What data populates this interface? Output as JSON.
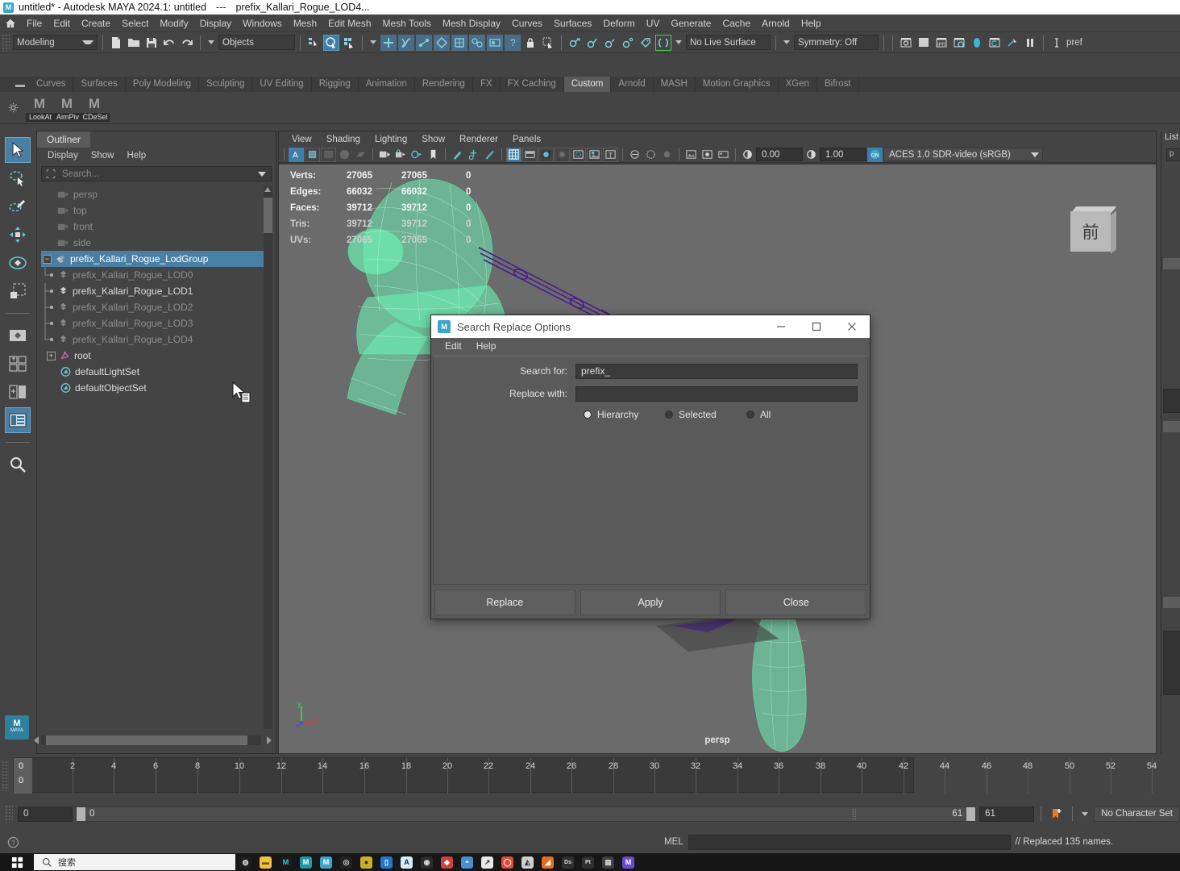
{
  "titlebar": {
    "app_icon": "maya-icon",
    "text": "untitled* - Autodesk MAYA 2024.1: untitled",
    "separator": "---",
    "object": "prefix_Kallari_Rogue_LOD4..."
  },
  "menubar": {
    "home_icon": "home-icon",
    "items": [
      "File",
      "Edit",
      "Create",
      "Select",
      "Modify",
      "Display",
      "Windows",
      "Mesh",
      "Edit Mesh",
      "Mesh Tools",
      "Mesh Display",
      "Curves",
      "Surfaces",
      "Deform",
      "UV",
      "Generate",
      "Cache",
      "Arnold",
      "Help"
    ]
  },
  "toolbar": {
    "mode": "Modeling",
    "objects": "Objects",
    "live_surface": "No Live Surface",
    "symmetry": "Symmetry: Off",
    "icons": [
      "new-scene-icon",
      "open-scene-icon",
      "save-scene-icon",
      "undo-icon",
      "redo-icon",
      "select-hierarchy-icon",
      "select-object-icon",
      "select-component-icon",
      "snap-grid-icon",
      "snap-curve-icon",
      "snap-point-icon",
      "snap-projected-icon",
      "snap-view-plane-icon",
      "make-live-icon",
      "render-icon",
      "render-sequence-icon",
      "ipr-render-icon",
      "render-settings-icon",
      "hypershade-icon",
      "render-view-icon",
      "light-editor-icon",
      "pause-icon",
      "text-cursor-icon"
    ]
  },
  "shelf": {
    "tabs": [
      "Curves",
      "Surfaces",
      "Poly Modeling",
      "Sculpting",
      "UV Editing",
      "Rigging",
      "Animation",
      "Rendering",
      "FX",
      "FX Caching",
      "Custom",
      "Arnold",
      "MASH",
      "Motion Graphics",
      "XGen",
      "Bifrost"
    ],
    "active_tab": "Custom",
    "buttons": [
      {
        "label": "LookAt",
        "icon": "mel-script-icon"
      },
      {
        "label": "AimPiv",
        "icon": "mel-script-icon"
      },
      {
        "label": "CDeSel",
        "icon": "mel-script-icon"
      }
    ],
    "gear_icon": "gear-icon"
  },
  "toolbox": {
    "tools": [
      {
        "name": "select-tool",
        "active": true
      },
      {
        "name": "lasso-select-tool",
        "active": false
      },
      {
        "name": "paint-select-tool",
        "active": false
      },
      {
        "name": "move-tool",
        "active": false
      },
      {
        "name": "rotate-tool",
        "active": false
      },
      {
        "name": "scale-tool",
        "active": false
      },
      {
        "name": "last-tool",
        "active": false
      },
      {
        "name": "single-pane-layout",
        "active": false
      },
      {
        "name": "four-pane-layout",
        "active": false
      },
      {
        "name": "two-pane-layout",
        "active": false
      },
      {
        "name": "outliner-persp-layout",
        "active": true
      },
      {
        "name": "search-tool",
        "active": false
      }
    ],
    "logo": "MAYA"
  },
  "outliner": {
    "tab_label": "Outliner",
    "menus": [
      "Display",
      "Show",
      "Help"
    ],
    "search_placeholder": "Search...",
    "search_value": "",
    "filter_icon": "selection-filter-icon",
    "dropdown_icon": "chevron-down-icon",
    "tree": [
      {
        "label": "persp",
        "icon": "camera-icon",
        "depth": 1,
        "state": "dim"
      },
      {
        "label": "top",
        "icon": "camera-icon",
        "depth": 1,
        "state": "dim"
      },
      {
        "label": "front",
        "icon": "camera-icon",
        "depth": 1,
        "state": "dim"
      },
      {
        "label": "side",
        "icon": "camera-icon",
        "depth": 1,
        "state": "dim"
      },
      {
        "label": "prefix_Kallari_Rogue_LodGroup",
        "icon": "lod-group-icon",
        "depth": 0,
        "state": "selected",
        "expander": "minus"
      },
      {
        "label": "prefix_Kallari_Rogue_LOD0",
        "icon": "mesh-icon",
        "depth": 2,
        "state": "dim"
      },
      {
        "label": "prefix_Kallari_Rogue_LOD1",
        "icon": "mesh-icon",
        "depth": 2,
        "state": "bright"
      },
      {
        "label": "prefix_Kallari_Rogue_LOD2",
        "icon": "mesh-icon",
        "depth": 2,
        "state": "dim"
      },
      {
        "label": "prefix_Kallari_Rogue_LOD3",
        "icon": "mesh-icon",
        "depth": 2,
        "state": "dim"
      },
      {
        "label": "prefix_Kallari_Rogue_LOD4",
        "icon": "mesh-icon",
        "depth": 2,
        "state": "dim"
      },
      {
        "label": "root",
        "icon": "joint-icon",
        "depth": 0,
        "state": "bright",
        "expander": "plus"
      },
      {
        "label": "defaultLightSet",
        "icon": "set-icon",
        "depth": 1,
        "state": "bright"
      },
      {
        "label": "defaultObjectSet",
        "icon": "set-icon",
        "depth": 1,
        "state": "bright"
      }
    ]
  },
  "viewport": {
    "menus": [
      "View",
      "Shading",
      "Lighting",
      "Show",
      "Renderer",
      "Panels"
    ],
    "camera_label": "persp",
    "viewcube_face": "前",
    "exposure": "0.00",
    "gamma": "1.00",
    "color_space": "ACES 1.0 SDR-video (sRGB)",
    "axis": {
      "x": "x",
      "y": "y",
      "z": "z"
    },
    "heads_up": {
      "columns": [
        "name",
        "count1",
        "count2",
        "count3"
      ],
      "rows": [
        {
          "name": "Verts:",
          "count1": "27065",
          "count2": "27065",
          "count3": "0"
        },
        {
          "name": "Edges:",
          "count1": "66032",
          "count2": "66032",
          "count3": "0"
        },
        {
          "name": "Faces:",
          "count1": "39712",
          "count2": "39712",
          "count3": "0"
        },
        {
          "name": "Tris:",
          "count1": "39712",
          "count2": "39712",
          "count3": "0"
        },
        {
          "name": "UVs:",
          "count1": "27065",
          "count2": "27065",
          "count3": "0"
        }
      ]
    }
  },
  "right_panel": {
    "tab_label": "List",
    "field_value": "p"
  },
  "dialog": {
    "title": "Search Replace Options",
    "icon": "maya-icon",
    "menus": [
      "Edit",
      "Help"
    ],
    "fields": [
      {
        "label": "Search for:",
        "value": "prefix_",
        "name": "search-for-field"
      },
      {
        "label": "Replace with:",
        "value": "",
        "name": "replace-with-field"
      }
    ],
    "scope_options": [
      {
        "label": "Hierarchy",
        "selected": true
      },
      {
        "label": "Selected",
        "selected": false
      },
      {
        "label": "All",
        "selected": false
      }
    ],
    "buttons": [
      "Replace",
      "Apply",
      "Close"
    ],
    "window_controls": {
      "minimize": "—",
      "maximize": "□",
      "close": "✕"
    }
  },
  "timeline": {
    "start": "0",
    "current": "0",
    "ticks": [
      "0",
      "2",
      "4",
      "6",
      "8",
      "10",
      "12",
      "14",
      "16",
      "18",
      "20",
      "22",
      "24",
      "26",
      "28",
      "30",
      "32",
      "34",
      "36",
      "38",
      "40",
      "42",
      "44",
      "46",
      "48",
      "50",
      "52",
      "54"
    ],
    "current_frame_label": "0"
  },
  "range_slider": {
    "range_start": "0",
    "anim_start": "0",
    "anim_end": "61",
    "range_end": "61",
    "character_set": "No Character Set",
    "key_icon": "add-key-icon"
  },
  "command_line": {
    "help_icon": "help-icon",
    "language": "MEL",
    "input_value": "",
    "result": "// Replaced 135 names."
  },
  "taskbar": {
    "start_icon": "windows-start-icon",
    "search_placeholder": "搜索",
    "search_icon": "search-icon",
    "apps": [
      {
        "name": "cortana-icon",
        "color": "#1d1d1d",
        "glyph": "◍"
      },
      {
        "name": "file-explorer-icon",
        "color": "#f0c040",
        "glyph": "▬"
      },
      {
        "name": "maya-app-icon",
        "color": "#1a1a1a",
        "glyph": "M"
      },
      {
        "name": "maya-app-icon-2",
        "color": "#2196a8",
        "glyph": "M"
      },
      {
        "name": "maya-app-icon-3",
        "color": "#3aa6c9",
        "glyph": "M"
      },
      {
        "name": "substance-icon",
        "color": "#222222",
        "glyph": "◎"
      },
      {
        "name": "zbrush-icon",
        "color": "#c9b02a",
        "glyph": "●"
      },
      {
        "name": "unreal-icon",
        "color": "#2277cc",
        "glyph": "▯"
      },
      {
        "name": "photoshop-icon",
        "color": "#d6eefc",
        "glyph": "A"
      },
      {
        "name": "marmoset-icon",
        "color": "#2b2b2b",
        "glyph": "◉"
      },
      {
        "name": "houdini-icon",
        "color": "#d04040",
        "glyph": "◆"
      },
      {
        "name": "blender-icon",
        "color": "#4a8fd0",
        "glyph": "◓"
      },
      {
        "name": "runner-icon",
        "color": "#e8e8e8",
        "glyph": "↗"
      },
      {
        "name": "chrome-icon",
        "color": "#dd4b39",
        "glyph": "◯"
      },
      {
        "name": "knife-icon",
        "color": "#cfcfcf",
        "glyph": "◭"
      },
      {
        "name": "flame-icon",
        "color": "#e07020",
        "glyph": "◢"
      },
      {
        "name": "ds-icon",
        "color": "#303030",
        "glyph": "Ds"
      },
      {
        "name": "pt-icon",
        "color": "#303030",
        "glyph": "Pt"
      },
      {
        "name": "grid-icon",
        "color": "#3d3d3d",
        "glyph": "▦"
      },
      {
        "name": "bridge-icon",
        "color": "#6a4ad0",
        "glyph": "M"
      }
    ]
  }
}
